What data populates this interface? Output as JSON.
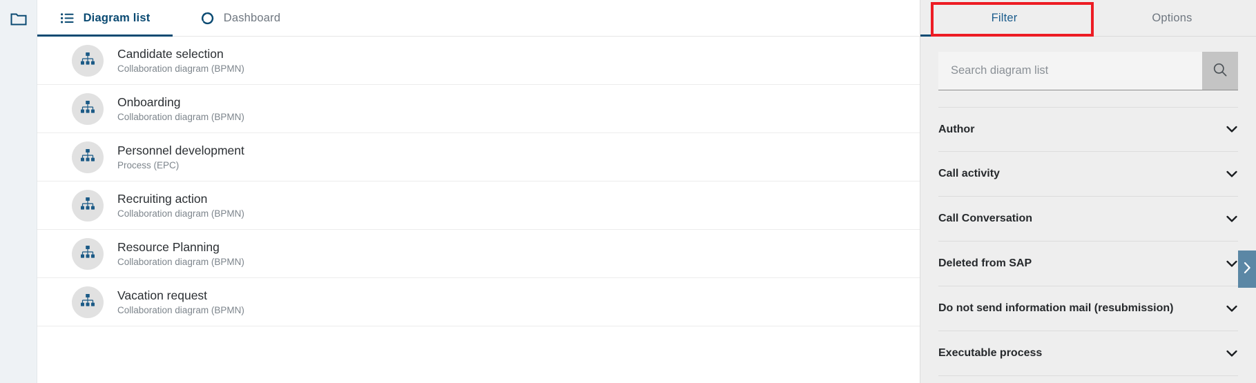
{
  "rail": {
    "folder_icon": "folder-icon"
  },
  "center": {
    "tabs": [
      {
        "label": "Diagram list",
        "icon": "list-icon",
        "active": true
      },
      {
        "label": "Dashboard",
        "icon": "donut-chart-icon",
        "active": false
      }
    ],
    "diagrams": [
      {
        "title": "Candidate selection",
        "subtitle": "Collaboration diagram (BPMN)",
        "icon": "hierarchy-icon"
      },
      {
        "title": "Onboarding",
        "subtitle": "Collaboration diagram (BPMN)",
        "icon": "hierarchy-icon"
      },
      {
        "title": "Personnel development",
        "subtitle": "Process (EPC)",
        "icon": "hierarchy-icon"
      },
      {
        "title": "Recruiting action",
        "subtitle": "Collaboration diagram (BPMN)",
        "icon": "hierarchy-icon"
      },
      {
        "title": "Resource Planning",
        "subtitle": "Collaboration diagram (BPMN)",
        "icon": "hierarchy-icon"
      },
      {
        "title": "Vacation request",
        "subtitle": "Collaboration diagram (BPMN)",
        "icon": "hierarchy-icon"
      }
    ]
  },
  "right": {
    "tabs": [
      {
        "label": "Filter",
        "active": true
      },
      {
        "label": "Options",
        "active": false
      }
    ],
    "search": {
      "value": "",
      "placeholder": "Search diagram list",
      "button_icon": "search-icon"
    },
    "filters": [
      {
        "label": "Author",
        "chevron": "chevron-down-icon",
        "expanded": false
      },
      {
        "label": "Call activity",
        "chevron": "chevron-down-icon",
        "expanded": false
      },
      {
        "label": "Call Conversation",
        "chevron": "chevron-down-icon",
        "expanded": false
      },
      {
        "label": "Deleted from SAP",
        "chevron": "chevron-down-icon",
        "expanded": false
      },
      {
        "label": "Do not send information mail (resubmission)",
        "chevron": "chevron-down-icon",
        "expanded": false
      },
      {
        "label": "Executable process",
        "chevron": "chevron-down-icon",
        "expanded": false
      }
    ],
    "collapse_handle_icon": "chevron-right-icon"
  },
  "annotation": {
    "highlight_color": "#ed1c24",
    "target": "Filter"
  },
  "colors": {
    "accent_blue": "#0a4a72",
    "panel_bg": "#eeeeee",
    "rail_bg": "#eef2f5",
    "handle_blue": "#5b87a5",
    "icon_blue": "#1b5a86",
    "avatar_bg": "#e1e1e1"
  }
}
